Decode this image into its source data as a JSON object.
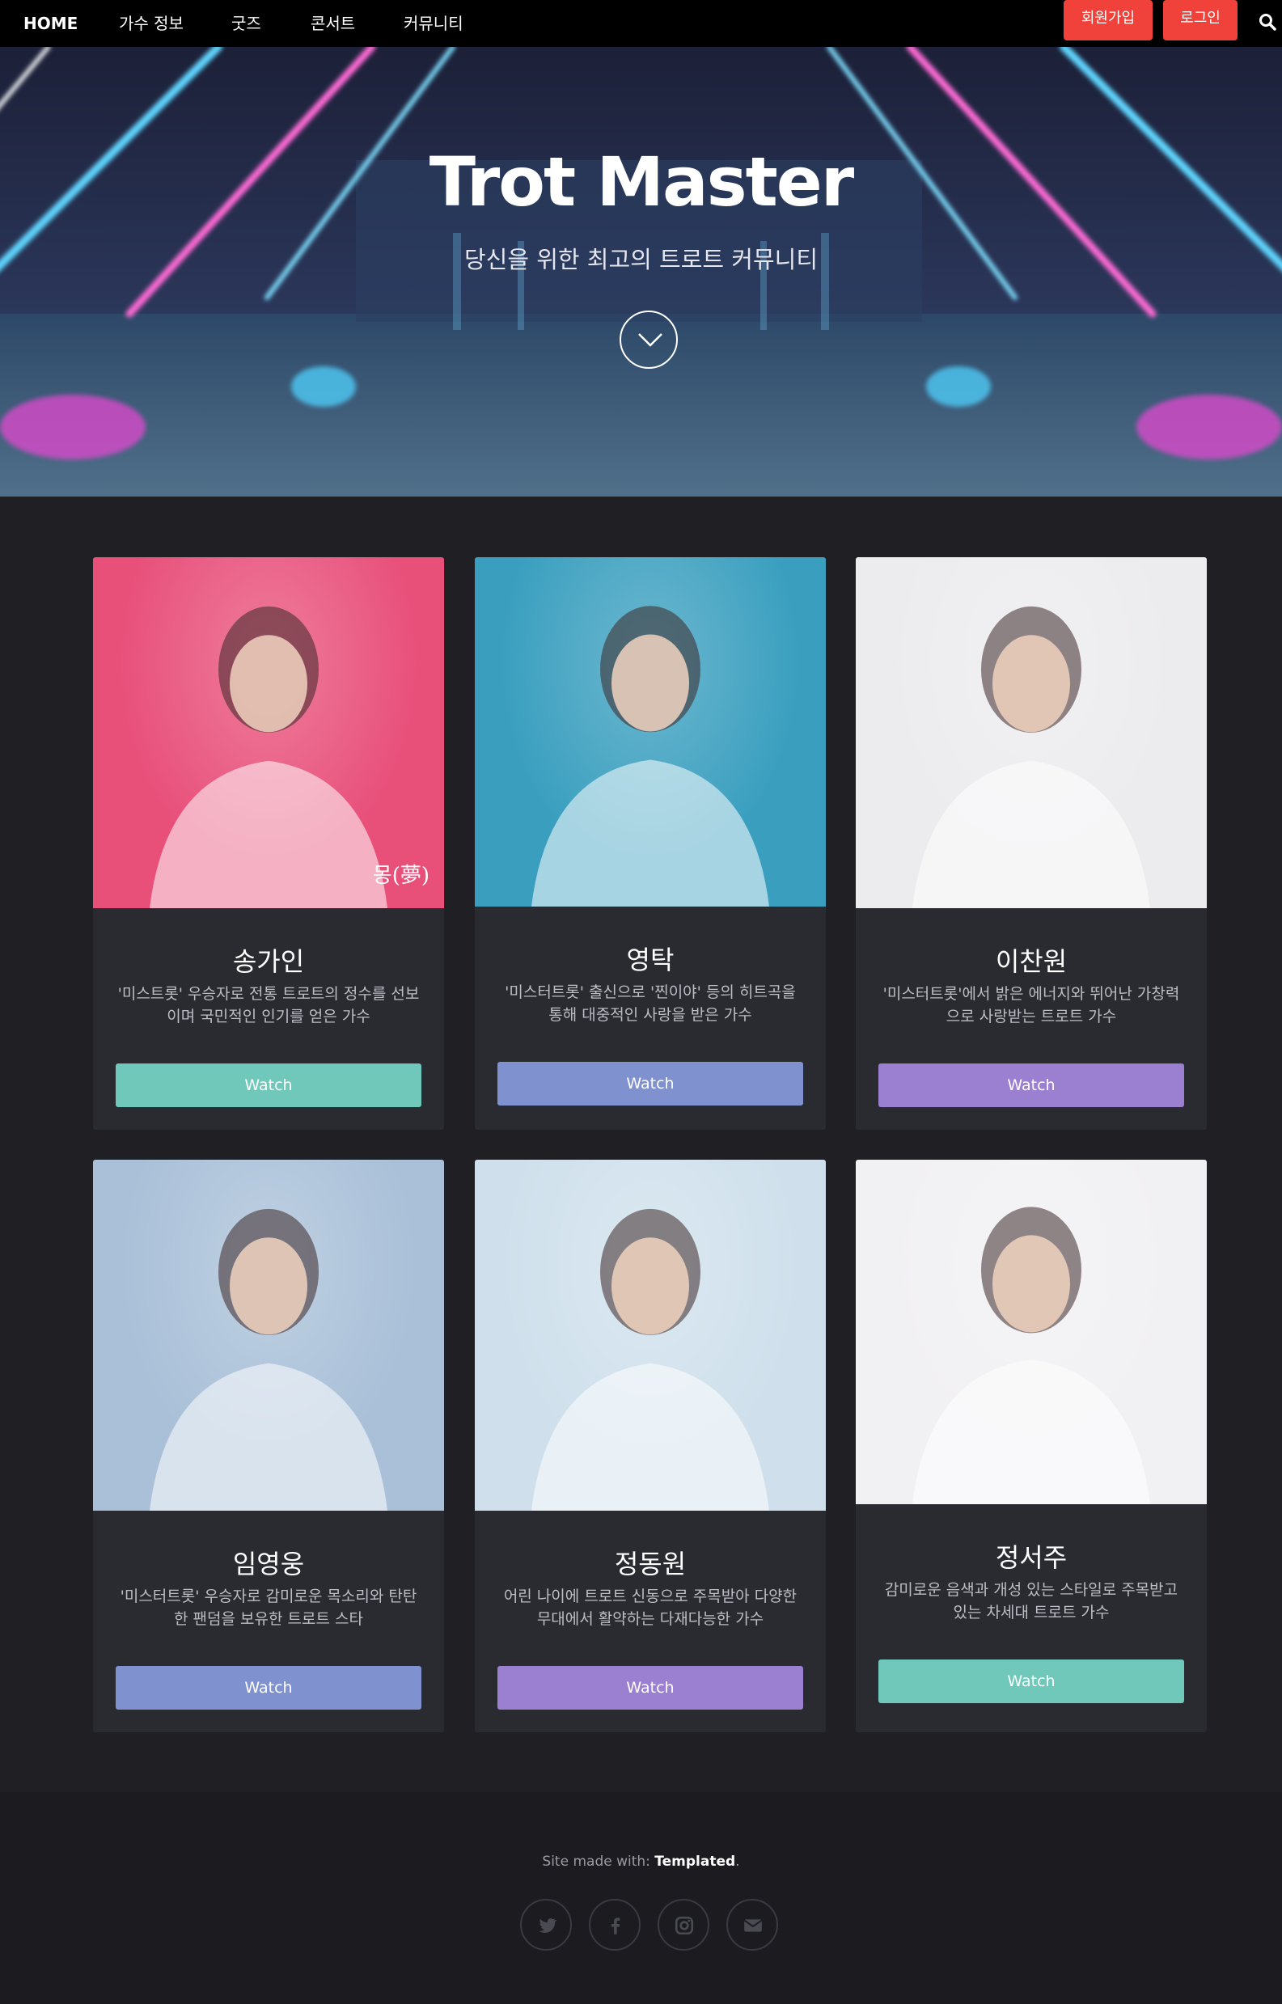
{
  "nav": {
    "items": [
      "HOME",
      "가수 정보",
      "굿즈",
      "콘서트",
      "커뮤니티"
    ],
    "signup_label": "회원가입",
    "login_label": "로그인",
    "search_icon": "search-icon"
  },
  "hero": {
    "title": "Trot Master",
    "subtitle": "당신을 위한 최고의 트로트 커뮤니티",
    "scroll_icon": "chevron-down-icon"
  },
  "singers": [
    {
      "name": "송가인",
      "description": "'미스트롯' 우승자로 전통 트로트의 정수를 선보이며 국민적인 인기를 얻은 가수",
      "button": "Watch",
      "button_color": "#6fc8b9",
      "photo_bg": "#e8507a",
      "album_text": "몽(夢)"
    },
    {
      "name": "영탁",
      "description": "'미스터트롯' 출신으로 '찐이야' 등의 히트곡을 통해 대중적인 사랑을 받은 가수",
      "button": "Watch",
      "button_color": "#7f92cf",
      "photo_bg": "#3a9fbf"
    },
    {
      "name": "이찬원",
      "description": "'미스터트롯'에서 밝은 에너지와 뛰어난 가창력으로 사랑받는 트로트 가수",
      "button": "Watch",
      "button_color": "#9b7fd0",
      "photo_bg": "#ecebee"
    },
    {
      "name": "임영웅",
      "description": "'미스터트롯' 우승자로 감미로운 목소리와 탄탄한 팬덤을 보유한 트로트 스타",
      "button": "Watch",
      "button_color": "#7f92cf",
      "photo_bg": "#a9c0d8"
    },
    {
      "name": "정동원",
      "description": "어린 나이에 트로트 신동으로 주목받아 다양한 무대에서 활약하는 다재다능한 가수",
      "button": "Watch",
      "button_color": "#9b7fd0",
      "photo_bg": "#cfe0ec"
    },
    {
      "name": "정서주",
      "description": "감미로운 음색과 개성 있는 스타일로 주목받고 있는 차세대 트로트 가수",
      "button": "Watch",
      "button_color": "#6fc8b9",
      "photo_bg": "#f1f0f3"
    }
  ],
  "footer": {
    "credit_prefix": "Site made with: ",
    "credit_brand": "Templated",
    "credit_suffix": ".",
    "social_icons": [
      "twitter-icon",
      "facebook-icon",
      "instagram-icon",
      "email-icon"
    ]
  }
}
